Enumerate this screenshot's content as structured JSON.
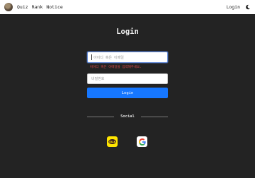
{
  "navbar": {
    "logo_icon": "avatar-logo-icon",
    "links": [
      "Quiz",
      "Rank",
      "Notice"
    ],
    "login_label": "Login",
    "theme_icon": "moon-icon"
  },
  "login": {
    "title": "Login",
    "id_placeholder": "아이디 혹은 이메일",
    "id_error": "아이디 혹은 이메일을 입력해주세요.",
    "password_placeholder": "비밀번호",
    "submit_label": "Login"
  },
  "social": {
    "label": "Social",
    "providers": [
      {
        "name": "kakao",
        "icon": "kakao-icon",
        "text": "TALK",
        "color": "#fee500"
      },
      {
        "name": "google",
        "icon": "google-icon"
      }
    ]
  },
  "colors": {
    "background": "#232323",
    "primary": "#1677ff",
    "error": "#e24a4a"
  }
}
